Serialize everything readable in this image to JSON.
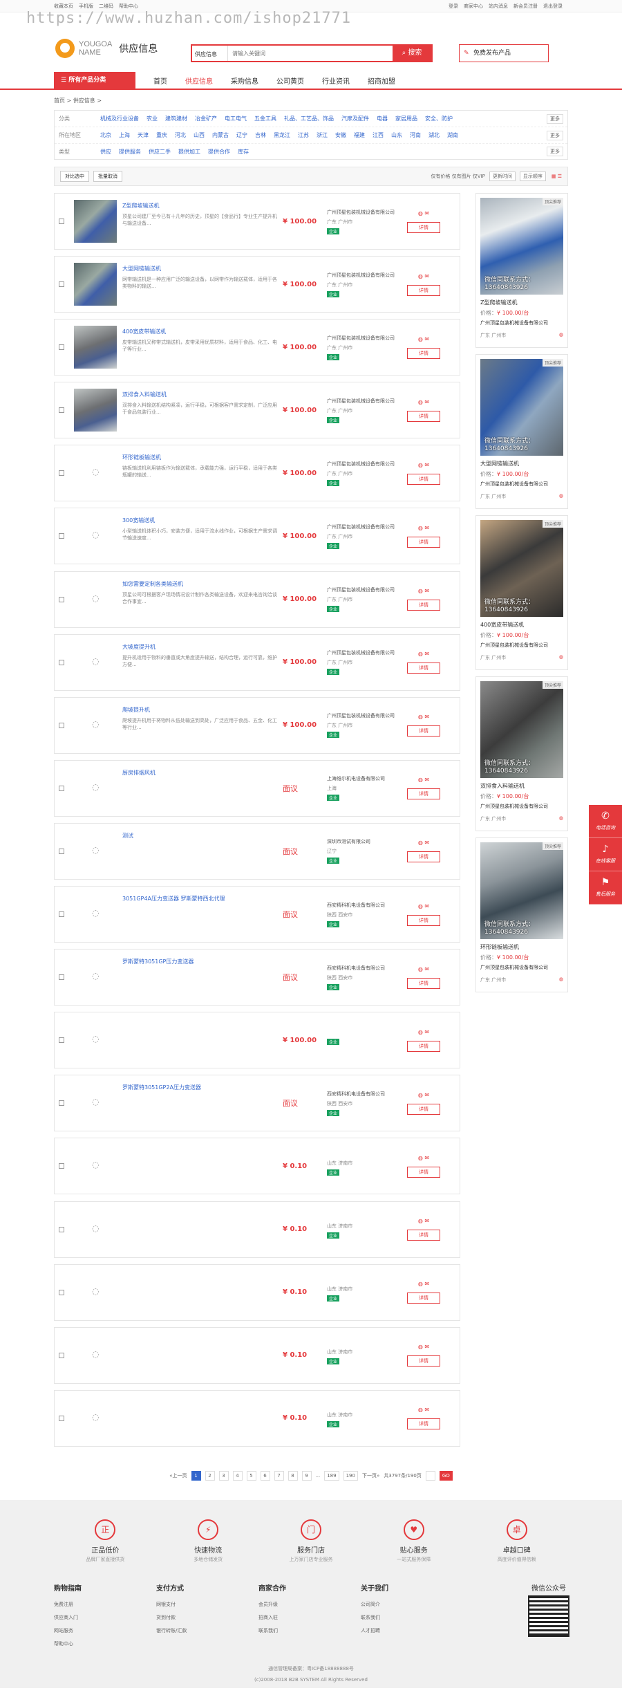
{
  "watermark": "https://www.huzhan.com/ishop21771",
  "topbar": {
    "left": [
      "收藏本页",
      "手机版",
      "二维码",
      "帮助中心"
    ],
    "right": [
      "登录",
      "商家中心",
      "站内消息",
      "新会员注册",
      "退出登录"
    ]
  },
  "logo": {
    "line1": "YOUGOA",
    "line2": "NAME",
    "section": "供应信息"
  },
  "search": {
    "category": "供应信息",
    "placeholder": "请输入关键词",
    "button": "搜索",
    "publish": "免费发布产品"
  },
  "nav": {
    "allcat": "所有产品分类",
    "items": [
      "首页",
      "供应信息",
      "采购信息",
      "公司黄页",
      "行业资讯",
      "招商加盟"
    ]
  },
  "breadcrumb": "首页 > 供应信息 >",
  "filters": [
    {
      "label": "分类",
      "options": [
        "机械及行业设备",
        "农业",
        "建筑建材",
        "冶金矿产",
        "电工电气",
        "五金工具",
        "礼品、工艺品、饰品",
        "汽摩及配件",
        "电器",
        "家居用品",
        "安全、防护"
      ],
      "more": "更多"
    },
    {
      "label": "所在地区",
      "options": [
        "北京",
        "上海",
        "天津",
        "重庆",
        "河北",
        "山西",
        "内蒙古",
        "辽宁",
        "吉林",
        "黑龙江",
        "江苏",
        "浙江",
        "安徽",
        "福建",
        "江西",
        "山东",
        "河南",
        "湖北",
        "湖南"
      ],
      "more": "更多"
    },
    {
      "label": "类型",
      "options": [
        "供应",
        "提供服务",
        "供应二手",
        "提供加工",
        "提供合作",
        "库存"
      ],
      "more": "更多"
    }
  ],
  "sortbar": {
    "compare": "对比选中",
    "cancel": "批量取消",
    "flags": "仅有价格  仅有图片  仅VIP",
    "sort1": "更新时间",
    "sort2": "显示顺序"
  },
  "list": [
    {
      "title": "Z型爬坡输送机",
      "desc": "顶星公司建厂至今已有十几年的历史，顶星的【食品行】专业生产提升机与输送设备...",
      "price": "¥ 100.00",
      "company": "广州顶星包装机械设备有限公司",
      "loc": "广东 广州市",
      "badge": "企业",
      "thumb": "img"
    },
    {
      "title": "大型网链输送机",
      "desc": "网带输送机是一种应用广泛的输送设备，以网带作为输送载体，适用于各类物料的输送...",
      "price": "¥ 100.00",
      "company": "广州顶星包装机械设备有限公司",
      "loc": "广东 广州市",
      "badge": "企业",
      "thumb": "img"
    },
    {
      "title": "400宽皮带输送机",
      "desc": "皮带输送机又称带式输送机，皮带采用优质材料，适用于食品、化工、电子等行业...",
      "price": "¥ 100.00",
      "company": "广州顶星包装机械设备有限公司",
      "loc": "广东 广州市",
      "badge": "企业",
      "thumb": "img2"
    },
    {
      "title": "双排食入料输送机",
      "desc": "双排食入料输送机结构紧凑，运行平稳，可根据客户需求定制，广泛应用于食品包装行业...",
      "price": "¥ 100.00",
      "company": "广州顶星包装机械设备有限公司",
      "loc": "广东 广州市",
      "badge": "企业",
      "thumb": "img2"
    },
    {
      "title": "环形链板输送机",
      "desc": "链板输送机利用链板作为输送载体，承载能力强，运行平稳，适用于各类瓶罐的输送...",
      "price": "¥ 100.00",
      "company": "广州顶星包装机械设备有限公司",
      "loc": "广东 广州市",
      "badge": "企业",
      "thumb": "blank"
    },
    {
      "title": "300宽输送机",
      "desc": "小型输送机体积小巧，安装方便，适用于流水线作业，可根据生产需求调节输送速度...",
      "price": "¥ 100.00",
      "company": "广州顶星包装机械设备有限公司",
      "loc": "广东 广州市",
      "badge": "企业",
      "thumb": "blank"
    },
    {
      "title": "如您需要定制各类输送机",
      "desc": "顶星公司可根据客户现场情况设计制作各类输送设备，欢迎来电咨询洽谈合作事宜...",
      "price": "¥ 100.00",
      "company": "广州顶星包装机械设备有限公司",
      "loc": "广东 广州市",
      "badge": "企业",
      "thumb": "blank"
    },
    {
      "title": "大坡度提升机",
      "desc": "提升机适用于物料的垂直或大角度提升输送，结构合理，运行可靠，维护方便...",
      "price": "¥ 100.00",
      "company": "广州顶星包装机械设备有限公司",
      "loc": "广东 广州市",
      "badge": "企业",
      "thumb": "blank"
    },
    {
      "title": "爬坡提升机",
      "desc": "爬坡提升机用于将物料从低处输送到高处，广泛应用于食品、五金、化工等行业...",
      "price": "¥ 100.00",
      "company": "广州顶星包装机械设备有限公司",
      "loc": "广东 广州市",
      "badge": "企业",
      "thumb": "blank"
    },
    {
      "title": "厨房排烟风机",
      "desc": "",
      "price": "面议",
      "company": "上海维尔机电设备有限公司",
      "loc": "上海",
      "badge": "企业",
      "thumb": "blank"
    },
    {
      "title": "测试",
      "desc": "",
      "price": "面议",
      "company": "深圳市测试有限公司",
      "loc": "辽宁",
      "badge": "企业",
      "thumb": "blank"
    },
    {
      "title": "3051GP4A压力变送器 罗斯蒙特西北代理",
      "desc": "",
      "price": "面议",
      "company": "西安精科机电设备有限公司",
      "loc": "陕西 西安市",
      "badge": "企业",
      "thumb": "blank"
    },
    {
      "title": "罗斯蒙特3051GP压力变送器",
      "desc": "",
      "price": "面议",
      "company": "西安精科机电设备有限公司",
      "loc": "陕西 西安市",
      "badge": "企业",
      "thumb": "blank"
    },
    {
      "title": "",
      "desc": "",
      "price": "¥ 100.00",
      "company": "",
      "loc": "",
      "badge": "企业",
      "thumb": "blank"
    },
    {
      "title": "罗斯蒙特3051GP2A压力变送器",
      "desc": "",
      "price": "面议",
      "company": "西安精科机电设备有限公司",
      "loc": "陕西 西安市",
      "badge": "企业",
      "thumb": "blank"
    },
    {
      "title": "",
      "desc": "",
      "price": "¥ 0.10",
      "company": "",
      "loc": "山东 济南市",
      "badge": "企业",
      "thumb": "blank"
    },
    {
      "title": "",
      "desc": "",
      "price": "¥ 0.10",
      "company": "",
      "loc": "山东 济南市",
      "badge": "企业",
      "thumb": "blank"
    },
    {
      "title": "",
      "desc": "",
      "price": "¥ 0.10",
      "company": "",
      "loc": "山东 济南市",
      "badge": "企业",
      "thumb": "blank"
    },
    {
      "title": "",
      "desc": "",
      "price": "¥ 0.10",
      "company": "",
      "loc": "山东 济南市",
      "badge": "企业",
      "thumb": "blank"
    },
    {
      "title": "",
      "desc": "",
      "price": "¥ 0.10",
      "company": "",
      "loc": "山东 济南市",
      "badge": "企业",
      "thumb": "blank"
    }
  ],
  "row_actions": {
    "detail": "详情"
  },
  "side": [
    {
      "wm": "微信同联系方式：13640843926",
      "tag": "顶尖推荐",
      "title": "Z型爬坡输送机",
      "price_label": "价格：",
      "price": "¥ 100.00/台",
      "company": "广州顶星包装机械设备有限公司",
      "loc": "广东 广州市",
      "pic": "c1"
    },
    {
      "wm": "微信同联系方式：13640843926",
      "tag": "顶尖推荐",
      "title": "大型网链输送机",
      "price_label": "价格：",
      "price": "¥ 100.00/台",
      "company": "广州顶星包装机械设备有限公司",
      "loc": "广东 广州市",
      "pic": "c2"
    },
    {
      "wm": "微信同联系方式：13640843926",
      "tag": "顶尖推荐",
      "title": "400宽皮带输送机",
      "price_label": "价格：",
      "price": "¥ 100.00/台",
      "company": "广州顶星包装机械设备有限公司",
      "loc": "广东 广州市",
      "pic": "c3"
    },
    {
      "wm": "微信同联系方式：13640843926",
      "tag": "顶尖推荐",
      "title": "双排食入料输送机",
      "price_label": "价格：",
      "price": "¥ 100.00/台",
      "company": "广州顶星包装机械设备有限公司",
      "loc": "广东 广州市",
      "pic": "c4"
    },
    {
      "wm": "微信同联系方式：13640843926",
      "tag": "顶尖推荐",
      "title": "环形链板输送机",
      "price_label": "价格：",
      "price": "¥ 100.00/台",
      "company": "广州顶星包装机械设备有限公司",
      "loc": "广东 广州市",
      "pic": "c5"
    }
  ],
  "float": [
    {
      "icon": "✆",
      "label": "电话咨询"
    },
    {
      "icon": "♪",
      "label": "在线客服"
    },
    {
      "icon": "⚑",
      "label": "售后服务"
    }
  ],
  "pager": {
    "prev": "«上一页",
    "pages": [
      "1",
      "2",
      "3",
      "4",
      "5",
      "6",
      "7",
      "8",
      "9"
    ],
    "dots": "...",
    "last": [
      "189",
      "190"
    ],
    "next": "下一页»",
    "total": "共3797条/190页",
    "go": "GO"
  },
  "footer": {
    "services": [
      {
        "icon": "正",
        "name": "正品低价",
        "sub": "品牌厂家直接供货"
      },
      {
        "icon": "⚡",
        "name": "快速物流",
        "sub": "多地仓储发货"
      },
      {
        "icon": "门",
        "name": "服务门店",
        "sub": "上万家门店专业服务"
      },
      {
        "icon": "♥",
        "name": "贴心服务",
        "sub": "一站式服务保障"
      },
      {
        "icon": "卓",
        "name": "卓越口碑",
        "sub": "高度评价值得信赖"
      }
    ],
    "cols": [
      {
        "h": "购物指南",
        "items": [
          "免费注册",
          "供应商入门",
          "网站服务",
          "帮助中心"
        ]
      },
      {
        "h": "支付方式",
        "items": [
          "网银支付",
          "货到付款",
          "银行转账/汇款"
        ]
      },
      {
        "h": "商家合作",
        "items": [
          "会员升级",
          "招商入驻",
          "联系我们"
        ]
      },
      {
        "h": "关于我们",
        "items": [
          "公司简介",
          "联系我们",
          "人才招聘"
        ]
      }
    ],
    "qr_title": "微信公众号",
    "icp": "通信管理局备案：粤ICP备18888888号",
    "copyright": "(c)2008-2018 B2B SYSTEM All Rights Reserved"
  }
}
